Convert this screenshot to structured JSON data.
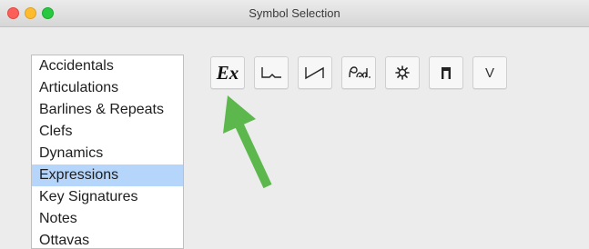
{
  "window": {
    "title": "Symbol Selection"
  },
  "categories": {
    "selected": "Expressions",
    "items": [
      {
        "label": "Accidentals"
      },
      {
        "label": "Articulations"
      },
      {
        "label": "Barlines & Repeats"
      },
      {
        "label": "Clefs"
      },
      {
        "label": "Dynamics"
      },
      {
        "label": "Expressions"
      },
      {
        "label": "Key Signatures"
      },
      {
        "label": "Notes"
      },
      {
        "label": "Ottavas"
      }
    ]
  },
  "symbol_buttons": [
    {
      "icon": "expression-text-icon",
      "label": "Ex"
    },
    {
      "icon": "pedal-bracket-icon"
    },
    {
      "icon": "pedal-line-icon"
    },
    {
      "icon": "pedal-ped-icon"
    },
    {
      "icon": "pedal-release-icon"
    },
    {
      "icon": "bracket-icon"
    },
    {
      "icon": "up-bow-icon",
      "label": "V"
    }
  ],
  "colors": {
    "selection": "#b5d5fb",
    "annotation_arrow": "#5cb84c",
    "close": "#fc5f57",
    "minimize": "#fdbb2d",
    "maximize": "#28c840"
  }
}
